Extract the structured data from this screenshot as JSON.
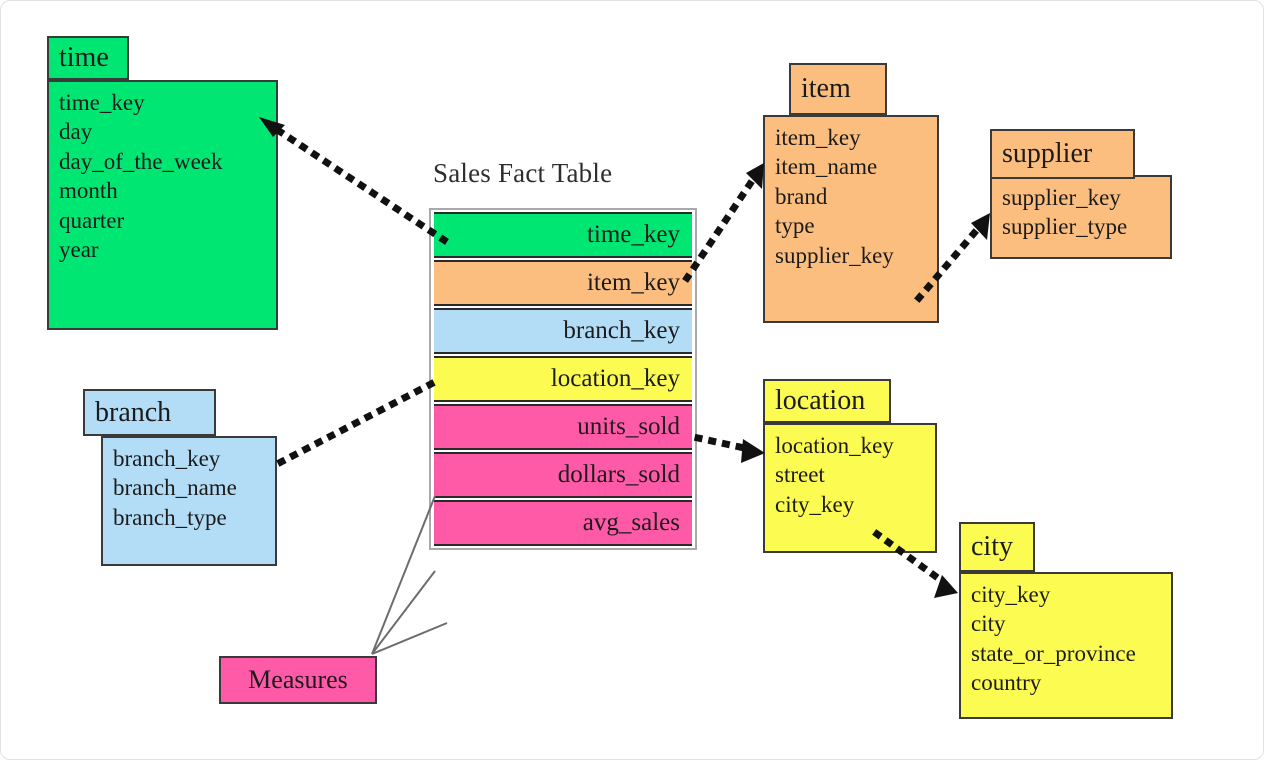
{
  "diagram": {
    "title": "Sales Fact Table",
    "type": "snowflake-schema"
  },
  "colors": {
    "time": "#00e673",
    "item": "#fcbe7f",
    "branch": "#b3ddf7",
    "location": "#fbfb52",
    "measures": "#ff5aa8",
    "outline": "#3a3a3a",
    "connector": "#111111",
    "measure_line": "#6d6d6d"
  },
  "fact_table": {
    "title": "Sales Fact Table",
    "rows": [
      {
        "label": "time_key",
        "color": "#00e673",
        "kind": "key"
      },
      {
        "label": "item_key",
        "color": "#fcbe7f",
        "kind": "key"
      },
      {
        "label": "branch_key",
        "color": "#b3ddf7",
        "kind": "key"
      },
      {
        "label": "location_key",
        "color": "#fbfb52",
        "kind": "key"
      },
      {
        "label": "units_sold",
        "color": "#ff5aa8",
        "kind": "measure"
      },
      {
        "label": "dollars_sold",
        "color": "#ff5aa8",
        "kind": "measure"
      },
      {
        "label": "avg_sales",
        "color": "#ff5aa8",
        "kind": "measure"
      }
    ]
  },
  "measures_box": {
    "label": "Measures"
  },
  "dimensions": {
    "time": {
      "name": "time",
      "fields": [
        "time_key",
        "day",
        "day_of_the_week",
        "month",
        "quarter",
        "year"
      ]
    },
    "branch": {
      "name": "branch",
      "fields": [
        "branch_key",
        "branch_name",
        "branch_type"
      ]
    },
    "item": {
      "name": "item",
      "fields": [
        "item_key",
        "item_name",
        "brand",
        "type",
        "supplier_key"
      ]
    },
    "supplier": {
      "name": "supplier",
      "fields": [
        "supplier_key",
        "supplier_type"
      ]
    },
    "location": {
      "name": "location",
      "fields": [
        "location_key",
        "street",
        "city_key"
      ]
    },
    "city": {
      "name": "city",
      "fields": [
        "city_key",
        "city",
        "state_or_province",
        "country"
      ]
    }
  }
}
